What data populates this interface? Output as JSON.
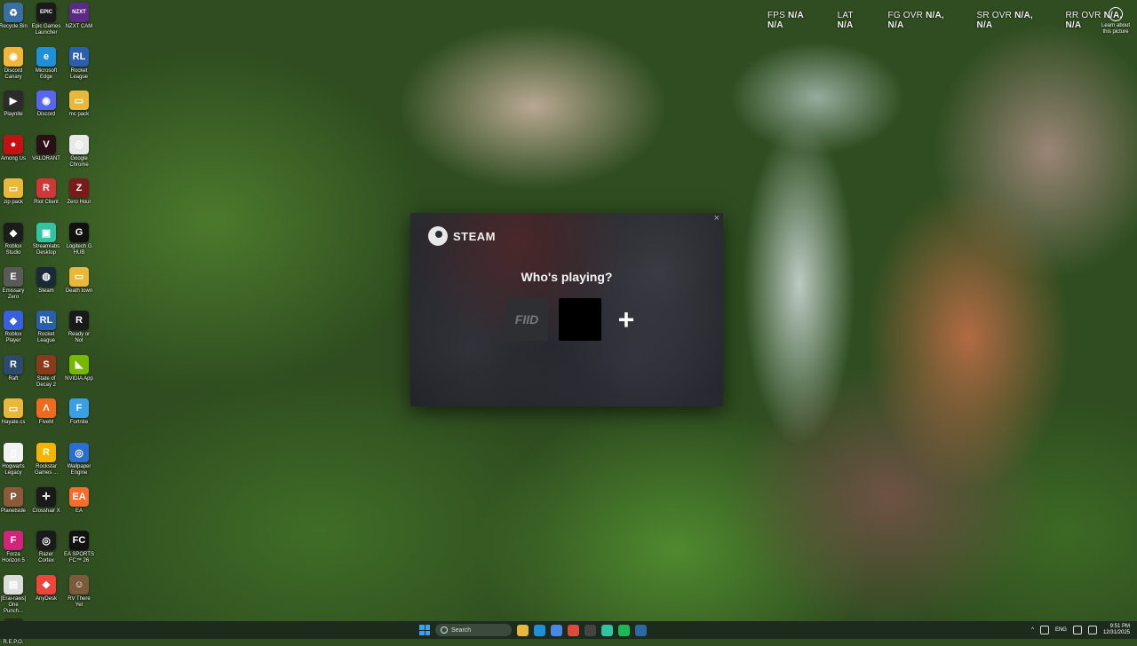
{
  "desktop": {
    "icons": [
      {
        "label": "Recycle Bin",
        "icon": "recycle-bin-icon",
        "color": "#3a6ea5",
        "glyph": "♻"
      },
      {
        "label": "Epic Games Launcher",
        "icon": "epic-games-icon",
        "color": "#1a1a1a",
        "glyph": "EPIC"
      },
      {
        "label": "NZXT CAM",
        "icon": "nzxt-cam-icon",
        "color": "#5b2a86",
        "glyph": "NZXT"
      },
      {
        "label": "Discord Canary",
        "icon": "discord-canary-icon",
        "color": "#f3b53a",
        "glyph": "◉"
      },
      {
        "label": "Microsoft Edge",
        "icon": "edge-icon",
        "color": "#1f8fd8",
        "glyph": "e"
      },
      {
        "label": "Rocket League",
        "icon": "rocket-league-icon",
        "color": "#2a5fb0",
        "glyph": "RL"
      },
      {
        "label": "Playnite",
        "icon": "playnite-icon",
        "color": "#2b2b2b",
        "glyph": "▶"
      },
      {
        "label": "Discord",
        "icon": "discord-icon",
        "color": "#5865f2",
        "glyph": "◉"
      },
      {
        "label": "mc pack",
        "icon": "folder-icon",
        "color": "#e8b83a",
        "glyph": "▭"
      },
      {
        "label": "Among Us",
        "icon": "among-us-icon",
        "color": "#c51111",
        "glyph": "●"
      },
      {
        "label": "VALORANT",
        "icon": "valorant-icon",
        "color": "#2a0f16",
        "glyph": "V"
      },
      {
        "label": "Google Chrome",
        "icon": "chrome-icon",
        "color": "#e8e8e8",
        "glyph": "◎"
      },
      {
        "label": "zip pack",
        "icon": "zip-folder-icon",
        "color": "#e8b83a",
        "glyph": "▭"
      },
      {
        "label": "Riot Client",
        "icon": "riot-client-icon",
        "color": "#d13639",
        "glyph": "R"
      },
      {
        "label": "Zero Hour",
        "icon": "zero-hour-icon",
        "color": "#7a1b1b",
        "glyph": "Z"
      },
      {
        "label": "Roblox Studio",
        "icon": "roblox-studio-icon",
        "color": "#1c1c1c",
        "glyph": "◆"
      },
      {
        "label": "Streamlabs Desktop",
        "icon": "streamlabs-icon",
        "color": "#31c3a2",
        "glyph": "▣"
      },
      {
        "label": "Logitech G HUB",
        "icon": "logitech-ghub-icon",
        "color": "#111111",
        "glyph": "G"
      },
      {
        "label": "Emissary Zero",
        "icon": "emissary-zero-icon",
        "color": "#5a5a5a",
        "glyph": "E"
      },
      {
        "label": "Steam",
        "icon": "steam-icon",
        "color": "#1b2838",
        "glyph": "◍"
      },
      {
        "label": "Death town",
        "icon": "folder-icon",
        "color": "#e8b83a",
        "glyph": "▭"
      },
      {
        "label": "Roblox Player",
        "icon": "roblox-player-icon",
        "color": "#3a5ee0",
        "glyph": "◆"
      },
      {
        "label": "Rocket League",
        "icon": "rocket-league-icon",
        "color": "#2a5fb0",
        "glyph": "RL"
      },
      {
        "label": "Ready or Not",
        "icon": "ready-or-not-icon",
        "color": "#1a1a1a",
        "glyph": "R"
      },
      {
        "label": "Raft",
        "icon": "raft-icon",
        "color": "#2c4a6e",
        "glyph": "R"
      },
      {
        "label": "State of Decay 2",
        "icon": "state-of-decay-icon",
        "color": "#8a3a1a",
        "glyph": "S"
      },
      {
        "label": "NVIDIA App",
        "icon": "nvidia-icon",
        "color": "#76b900",
        "glyph": "◣"
      },
      {
        "label": "Hayate.cs",
        "icon": "folder-icon",
        "color": "#e8b83a",
        "glyph": "▭"
      },
      {
        "label": "FiveM",
        "icon": "fivem-icon",
        "color": "#f06a1e",
        "glyph": "Λ"
      },
      {
        "label": "Fortnite",
        "icon": "fortnite-icon",
        "color": "#39a0e8",
        "glyph": "F"
      },
      {
        "label": "Hogwarts Legacy",
        "icon": "file-icon",
        "color": "#f2f2f2",
        "glyph": "▯"
      },
      {
        "label": "Rockstar Games ...",
        "icon": "rockstar-icon",
        "color": "#f4b400",
        "glyph": "R"
      },
      {
        "label": "Wallpaper Engine",
        "icon": "wallpaper-engine-icon",
        "color": "#2a6fd0",
        "glyph": "◎"
      },
      {
        "label": "Planetside",
        "icon": "planetside-icon",
        "color": "#8a5a3a",
        "glyph": "P"
      },
      {
        "label": "Crosshair X",
        "icon": "crosshair-icon",
        "color": "#1a1a1a",
        "glyph": "✛"
      },
      {
        "label": "EA",
        "icon": "ea-icon",
        "color": "#f56c2d",
        "glyph": "EA"
      },
      {
        "label": "Forza Horizon 5",
        "icon": "forza-horizon-icon",
        "color": "#d4237a",
        "glyph": "F"
      },
      {
        "label": "Razer Cortex",
        "icon": "razer-cortex-icon",
        "color": "#1a1a1a",
        "glyph": "◎"
      },
      {
        "label": "EA SPORTS FC™ 26",
        "icon": "ea-sports-fc-icon",
        "color": "#111111",
        "glyph": "FC"
      },
      {
        "label": "[Erai-raws] One Punch...",
        "icon": "video-file-icon",
        "color": "#dddddd",
        "glyph": "▤"
      },
      {
        "label": "AnyDesk",
        "icon": "anydesk-icon",
        "color": "#ef443b",
        "glyph": "◆"
      },
      {
        "label": "RV There Yet",
        "icon": "rv-there-yet-icon",
        "color": "#7a5a3a",
        "glyph": "☺"
      },
      {
        "label": "R.E.P.O.",
        "icon": "repo-icon",
        "color": "#2a2a1a",
        "glyph": "▣"
      }
    ]
  },
  "overlay": {
    "stats": [
      {
        "label": "FPS",
        "value": "N/A",
        "value2": "N/A"
      },
      {
        "label": "LAT",
        "value": "N/A",
        "value2": ""
      },
      {
        "label": "FG OVR",
        "value": "N/A,",
        "value2": "N/A"
      },
      {
        "label": "SR OVR",
        "value": "N/A,",
        "value2": "N/A"
      },
      {
        "label": "RR OVR",
        "value": "N/A,",
        "value2": "N/A"
      }
    ],
    "learn_more": "Learn about this picture"
  },
  "steam_dialog": {
    "brand": "STEAM",
    "heading": "Who's playing?",
    "profile1_tag": "FIID",
    "add_profile": "+",
    "close": "×"
  },
  "taskbar": {
    "search_placeholder": "Search",
    "apps": [
      {
        "icon": "file-explorer-icon",
        "color": "#e8b83a"
      },
      {
        "icon": "edge-icon",
        "color": "#1f8fd8"
      },
      {
        "icon": "store-icon",
        "color": "#4a88e8"
      },
      {
        "icon": "chrome-icon",
        "color": "#e04a3a"
      },
      {
        "icon": "terminal-icon",
        "color": "#444444"
      },
      {
        "icon": "streamlabs-icon",
        "color": "#31c3a2"
      },
      {
        "icon": "spotify-icon",
        "color": "#1db954"
      },
      {
        "icon": "steam-icon",
        "color": "#2a6aa0"
      }
    ],
    "language": "ENG",
    "time": "9:51 PM",
    "date": "12/31/2025"
  }
}
